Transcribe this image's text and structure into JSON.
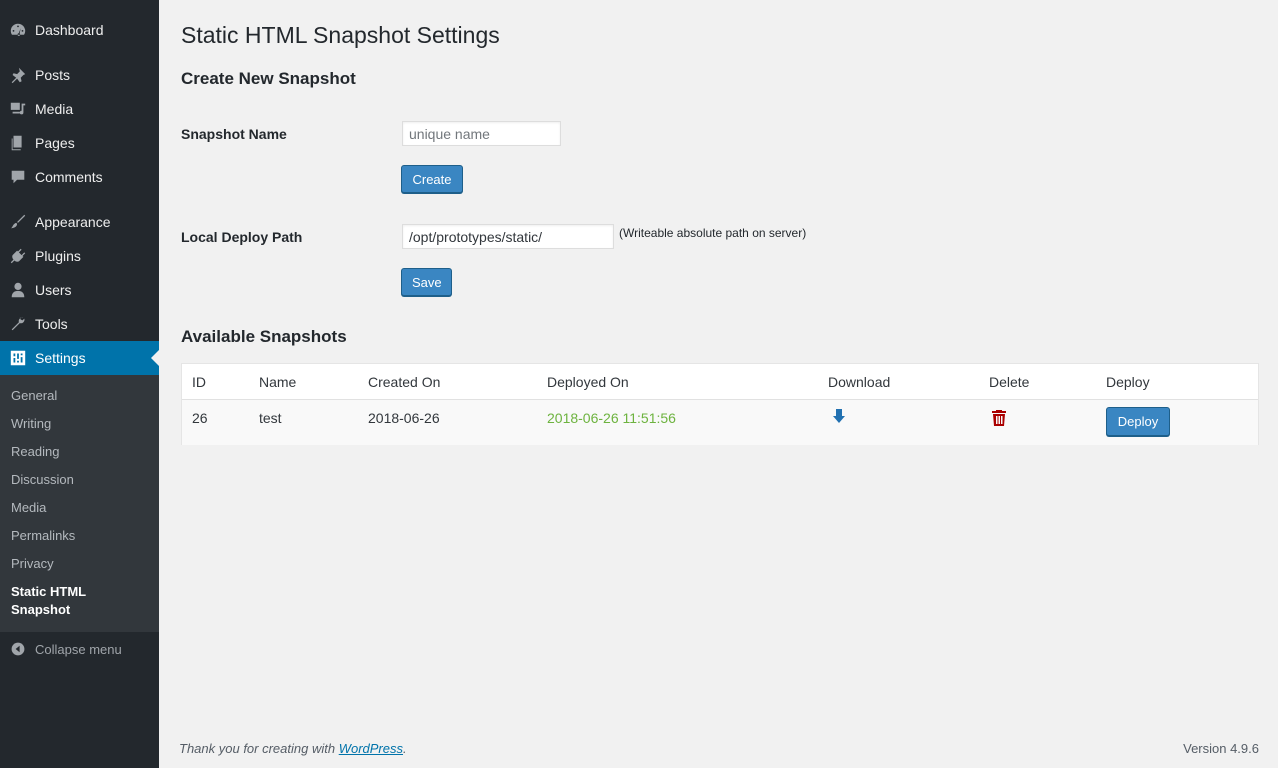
{
  "sidebar": {
    "items": [
      {
        "label": "Dashboard",
        "icon": "dashboard-icon"
      },
      {
        "label": "Posts",
        "icon": "pin-icon"
      },
      {
        "label": "Media",
        "icon": "media-icon"
      },
      {
        "label": "Pages",
        "icon": "pages-icon"
      },
      {
        "label": "Comments",
        "icon": "comment-icon"
      },
      {
        "label": "Appearance",
        "icon": "brush-icon"
      },
      {
        "label": "Plugins",
        "icon": "plugin-icon"
      },
      {
        "label": "Users",
        "icon": "user-icon"
      },
      {
        "label": "Tools",
        "icon": "wrench-icon"
      },
      {
        "label": "Settings",
        "icon": "settings-icon",
        "active": true
      }
    ],
    "submenu": [
      {
        "label": "General"
      },
      {
        "label": "Writing"
      },
      {
        "label": "Reading"
      },
      {
        "label": "Discussion"
      },
      {
        "label": "Media"
      },
      {
        "label": "Permalinks"
      },
      {
        "label": "Privacy"
      },
      {
        "label": "Static HTML Snapshot",
        "current": true
      }
    ],
    "collapse_label": "Collapse menu"
  },
  "page": {
    "title": "Static HTML Snapshot Settings",
    "create_heading": "Create New Snapshot",
    "snapshot_name_label": "Snapshot Name",
    "snapshot_name_placeholder": "unique name",
    "snapshot_name_value": "",
    "create_button": "Create",
    "deploy_path_label": "Local Deploy Path",
    "deploy_path_value": "/opt/prototypes/static/",
    "deploy_path_hint": "(Writeable absolute path on server)",
    "save_button": "Save",
    "available_heading": "Available Snapshots"
  },
  "table": {
    "headers": [
      "ID",
      "Name",
      "Created On",
      "Deployed On",
      "Download",
      "Delete",
      "Deploy"
    ],
    "rows": [
      {
        "id": "26",
        "name": "test",
        "created_on": "2018-06-26",
        "deployed_on": "2018-06-26 11:51:56",
        "deploy_button": "Deploy"
      }
    ]
  },
  "colors": {
    "sidebar_bg": "#23282d",
    "active_bg": "#0073aa",
    "deployed_text": "#6db33f",
    "delete_icon": "#aa0000",
    "button_bg": "#3a86c2"
  },
  "footer": {
    "thanks_prefix": "Thank you for creating with ",
    "thanks_link": "WordPress",
    "thanks_suffix": ".",
    "version": "Version 4.9.6"
  }
}
